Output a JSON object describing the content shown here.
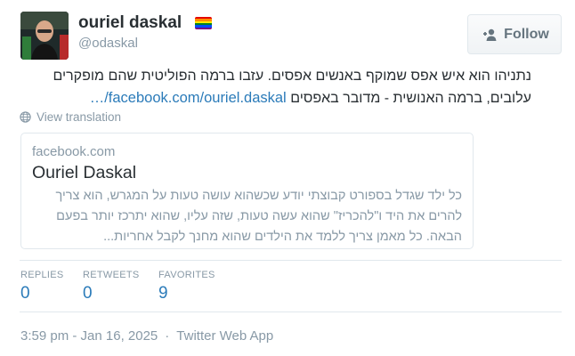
{
  "author": {
    "name": "ouriel daskal",
    "handle": "@odaskal",
    "flag_icon": "rainbow-flag-icon",
    "flag_colors": [
      "#e40303",
      "#ff8c00",
      "#ffed00",
      "#008026",
      "#004dff",
      "#750787"
    ]
  },
  "follow_button": {
    "label": "Follow",
    "icon": "add-user-icon"
  },
  "tweet": {
    "line1": "נתניהו הוא איש אפס שמוקף באנשים אפסים. עזבו ברמה הפוליטית שהם מופקרים",
    "line2": "עלובים, ברמה האנושית - מדובר באפסים",
    "link": "facebook.com/ouriel.daskal/…"
  },
  "view_translation": {
    "label": "View translation",
    "icon": "globe-icon"
  },
  "card": {
    "domain": "facebook.com",
    "title": "Ouriel Daskal",
    "desc_line1": "כל ילד שגדל בספורט קבוצתי יודע שכשהוא עושה טעות על המגרש, הוא צריך",
    "desc_line2": "להרים את היד ו\"להכריז\" שהוא עשה טעות, שזה עליו, שהוא יתרכז יותר בפעם",
    "desc_line3": "הבאה. כל מאמן צריך ללמד את הילדים שהוא מחנך לקבל אחריות..."
  },
  "stats": {
    "replies": {
      "label": "REPLIES",
      "value": "0"
    },
    "retweets": {
      "label": "RETWEETS",
      "value": "0"
    },
    "favorites": {
      "label": "FAVORITES",
      "value": "9"
    }
  },
  "meta": {
    "timestamp": "3:59 pm - Jan 16, 2025",
    "separator": "·",
    "source": "Twitter Web App"
  },
  "colors": {
    "link": "#2b7bb9",
    "muted": "#8899a6",
    "text": "#292f33",
    "border": "#e1e8ed"
  }
}
